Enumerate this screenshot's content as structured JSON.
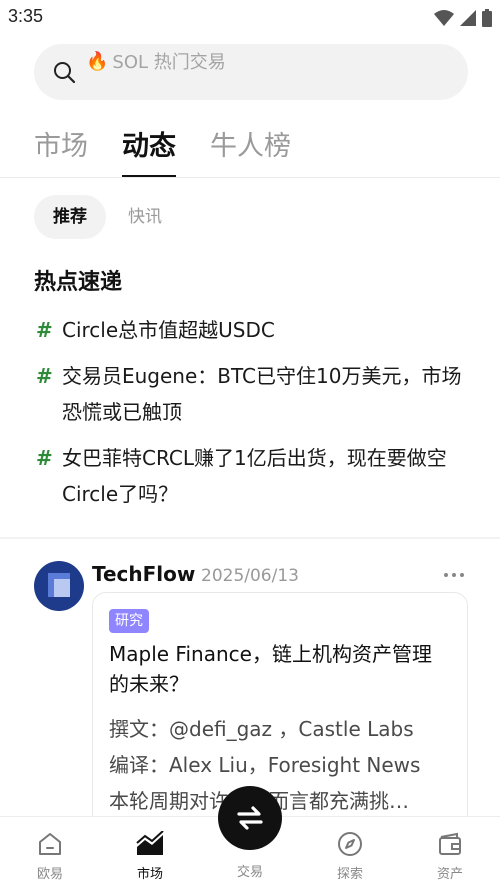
{
  "status_bar": {
    "time": "3:35"
  },
  "search": {
    "placeholder": "SOL 热门交易",
    "prefix_icon": "fire-icon"
  },
  "main_tabs": [
    {
      "label": "市场",
      "active": false
    },
    {
      "label": "动态",
      "active": true
    },
    {
      "label": "牛人榜",
      "active": false
    }
  ],
  "sub_tabs": [
    {
      "label": "推荐",
      "active": true
    },
    {
      "label": "快讯",
      "active": false
    }
  ],
  "hot_section": {
    "title": "热点速递",
    "hash": "#",
    "items": [
      "Circle总市值超越USDC",
      "交易员Eugene：BTC已守住10万美元，市场恐慌或已触顶",
      "女巴菲特CRCL赚了1亿后出货，现在要做空Circle了吗？"
    ]
  },
  "post": {
    "author": "TechFlow",
    "date": "2025/06/13",
    "tag": "研究",
    "title": "Maple Finance，链上机构资产管理的未来？",
    "body_lines": [
      "撰文：@defi_gaz ，Castle Labs",
      "编译：Alex Liu，Foresight News",
      "本轮周期对许多人而言都充满挑…"
    ]
  },
  "bottom_nav": {
    "items": [
      {
        "label": "欧易",
        "icon": "home-icon",
        "active": false
      },
      {
        "label": "市场",
        "icon": "market-chart-icon",
        "active": true
      },
      {
        "label": "交易",
        "icon": "swap-icon",
        "active": false
      },
      {
        "label": "探索",
        "icon": "compass-icon",
        "active": false
      },
      {
        "label": "资产",
        "icon": "wallet-icon",
        "active": false
      }
    ]
  },
  "colors": {
    "hash": "#2e8b3a",
    "tag_bg": "#8f86ff",
    "avatar_bg": "#1e3a8a",
    "fab_bg": "#111111"
  }
}
